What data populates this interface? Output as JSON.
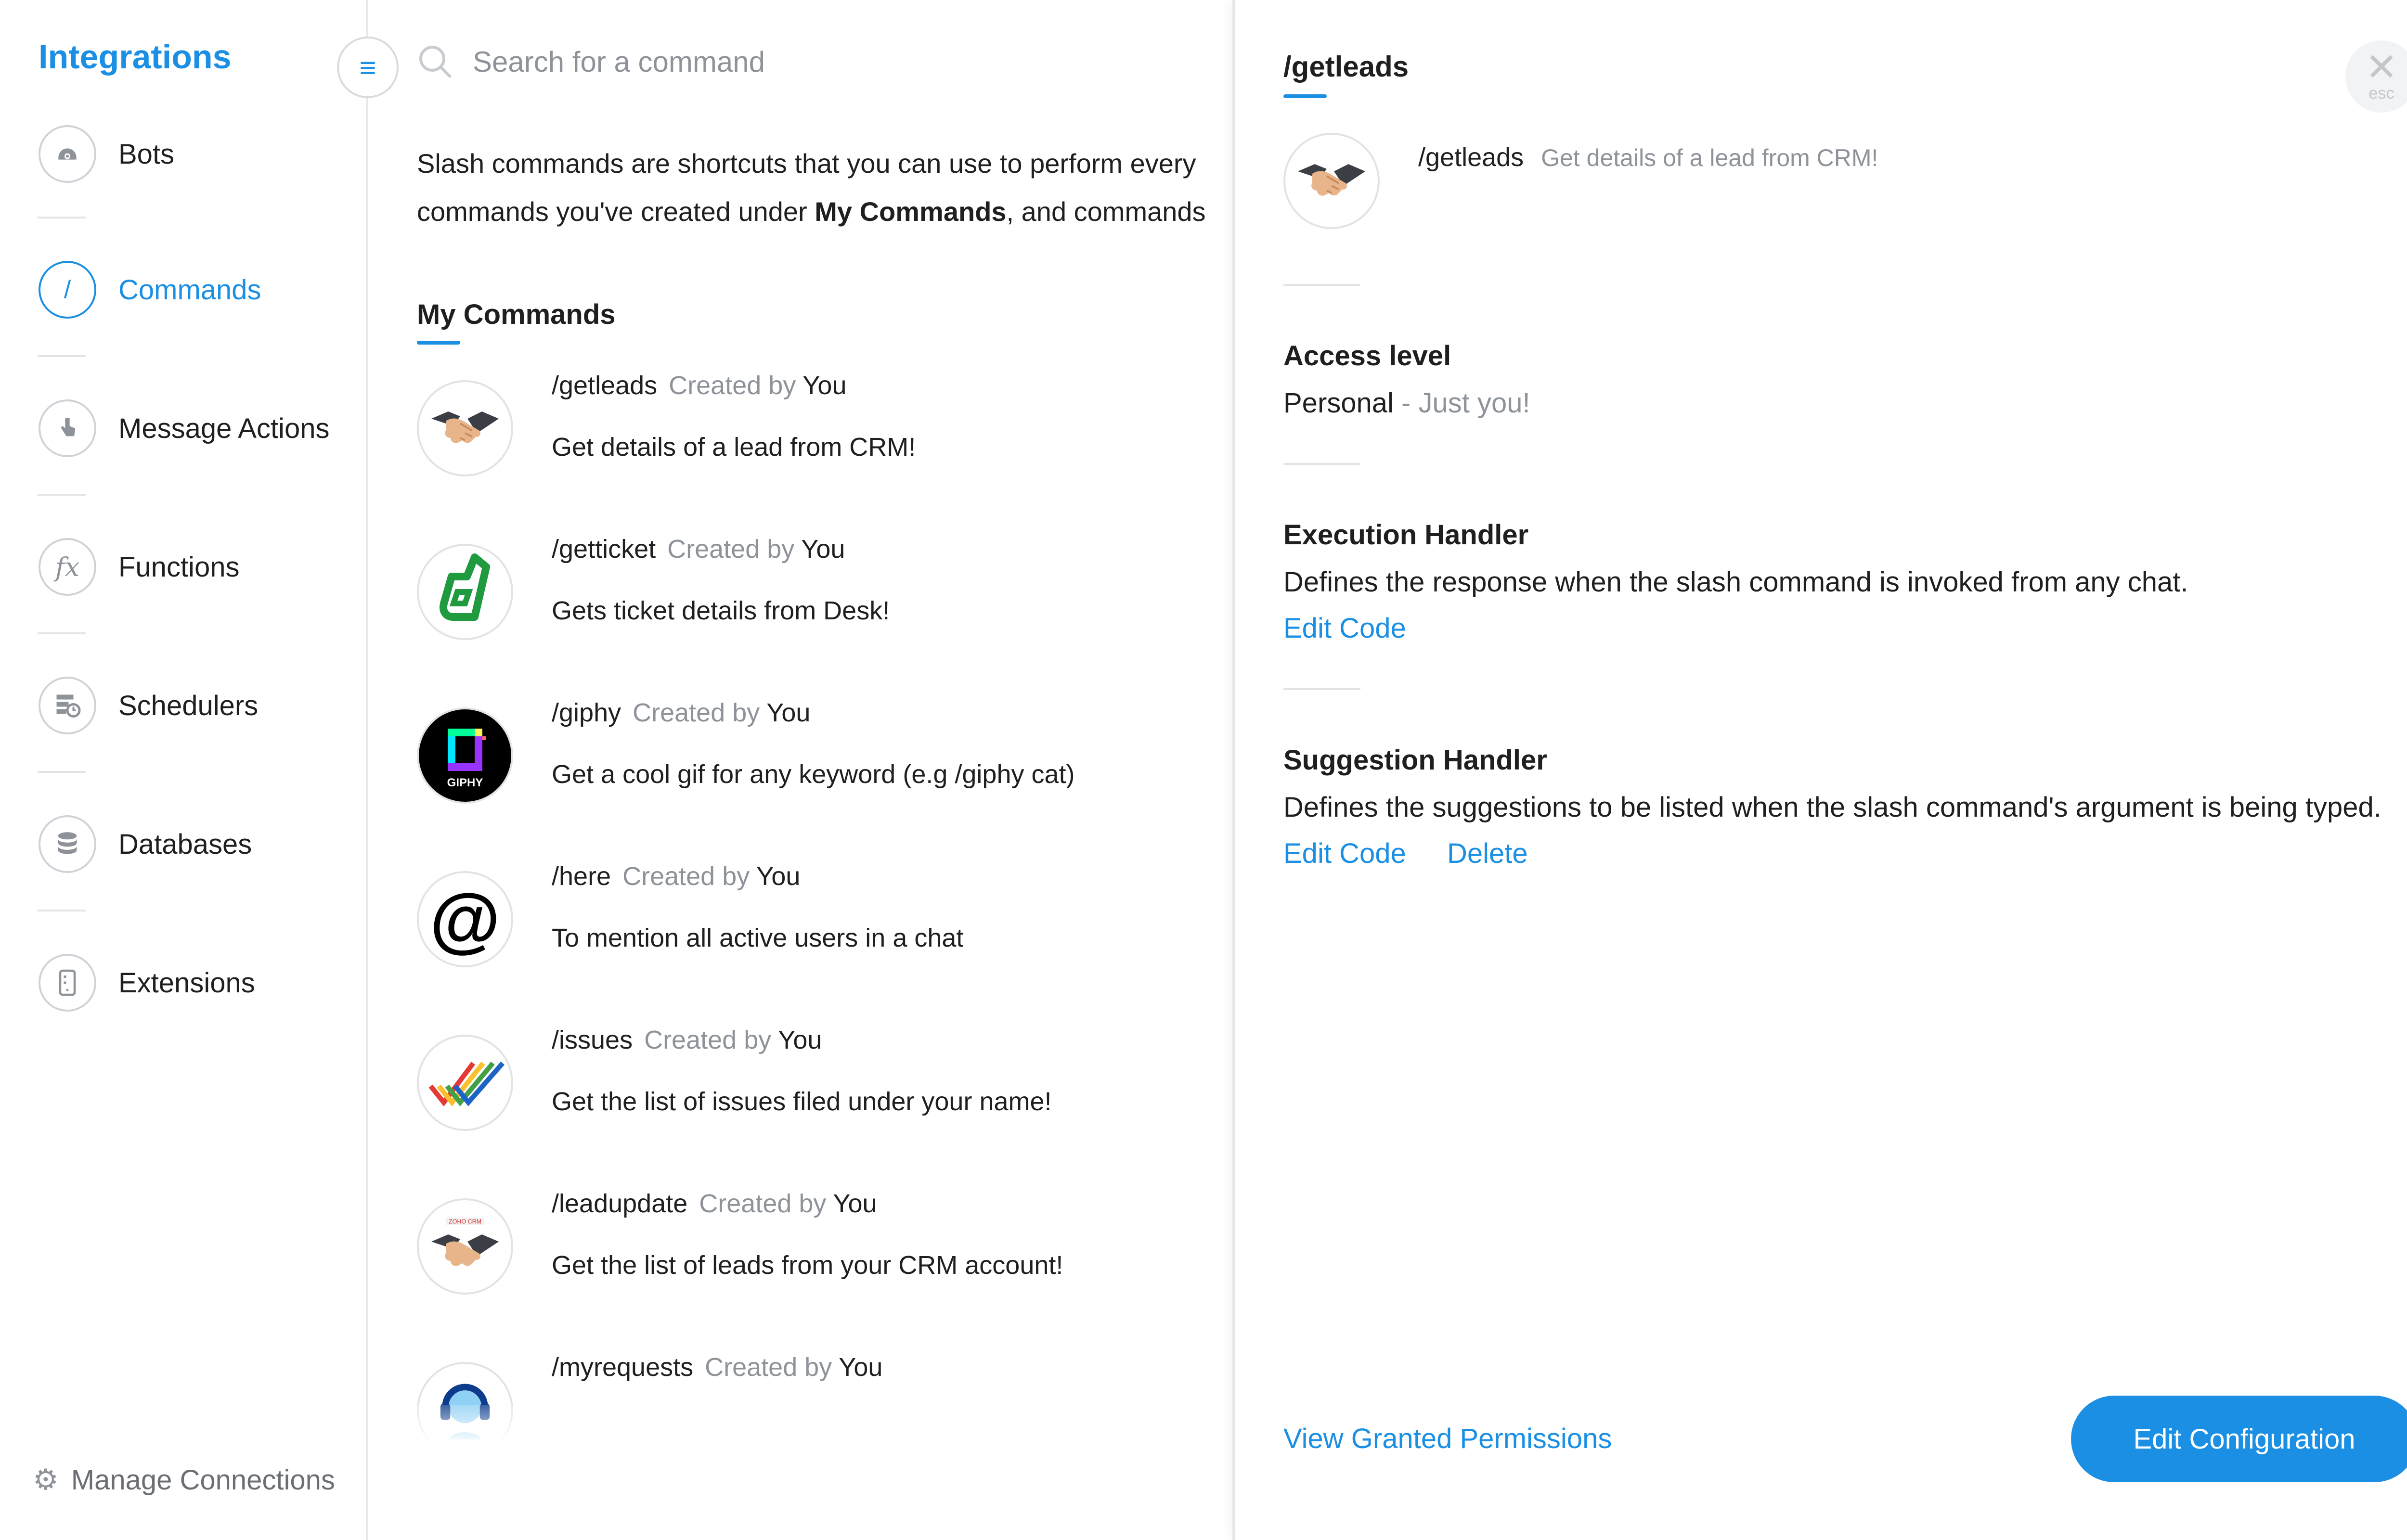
{
  "sidebar": {
    "title": "Integrations",
    "items": [
      {
        "label": "Bots",
        "icon": "bot-icon"
      },
      {
        "label": "Commands",
        "icon": "slash-icon",
        "active": true
      },
      {
        "label": "Message Actions",
        "icon": "pointer-hand-icon"
      },
      {
        "label": "Functions",
        "icon": "fx-icon"
      },
      {
        "label": "Schedulers",
        "icon": "scheduler-icon"
      },
      {
        "label": "Databases",
        "icon": "database-icon"
      },
      {
        "label": "Extensions",
        "icon": "extension-icon"
      }
    ],
    "manage_label": "Manage Connections"
  },
  "search": {
    "placeholder": "Search for a command"
  },
  "intro": {
    "line1": "Slash commands are shortcuts that you can use to perform every",
    "line2_pre": "commands you've created under ",
    "line2_bold": "My Commands",
    "line2_post": ", and commands"
  },
  "section_title": "My Commands",
  "created_by": "Created by",
  "you": "You",
  "commands": [
    {
      "name": "/getleads",
      "desc": "Get details of a lead from CRM!",
      "icon": "handshake-icon"
    },
    {
      "name": "/getticket",
      "desc": "Gets ticket details from Desk!",
      "icon": "desk-icon"
    },
    {
      "name": "/giphy",
      "desc": "Get a cool gif for any keyword (e.g /giphy cat)",
      "icon": "giphy-icon"
    },
    {
      "name": "/here",
      "desc": "To mention all active users in a chat",
      "icon": "at-sign-icon"
    },
    {
      "name": "/issues",
      "desc": "Get the list of issues filed under your name!",
      "icon": "checkmarks-icon"
    },
    {
      "name": "/leadupdate",
      "desc": "Get the list of leads from your CRM account!",
      "icon": "crm-handshake-icon"
    },
    {
      "name": "/myrequests",
      "desc": "",
      "icon": "headset-icon"
    }
  ],
  "giphy_logo_text": "GIPHY",
  "crm_badge_text": "ZOHO CRM",
  "panel": {
    "title": "/getleads",
    "close_esc": "esc",
    "detail_name": "/getleads",
    "detail_desc": "Get details of a lead from CRM!",
    "access_title": "Access level",
    "access_value": "Personal",
    "access_note": " - Just you!",
    "exec_title": "Execution Handler",
    "exec_text": "Defines the response when the slash command is invoked from any chat.",
    "exec_link": "Edit Code",
    "sugg_title": "Suggestion Handler",
    "sugg_text": "Defines the suggestions to be listed when the slash command's argument is being typed.",
    "sugg_edit": "Edit Code",
    "sugg_delete": "Delete",
    "permissions_link": "View Granted Permissions",
    "edit_config": "Edit Configuration"
  },
  "colors": {
    "accent": "#1a8fe3",
    "muted": "#8e939a"
  }
}
